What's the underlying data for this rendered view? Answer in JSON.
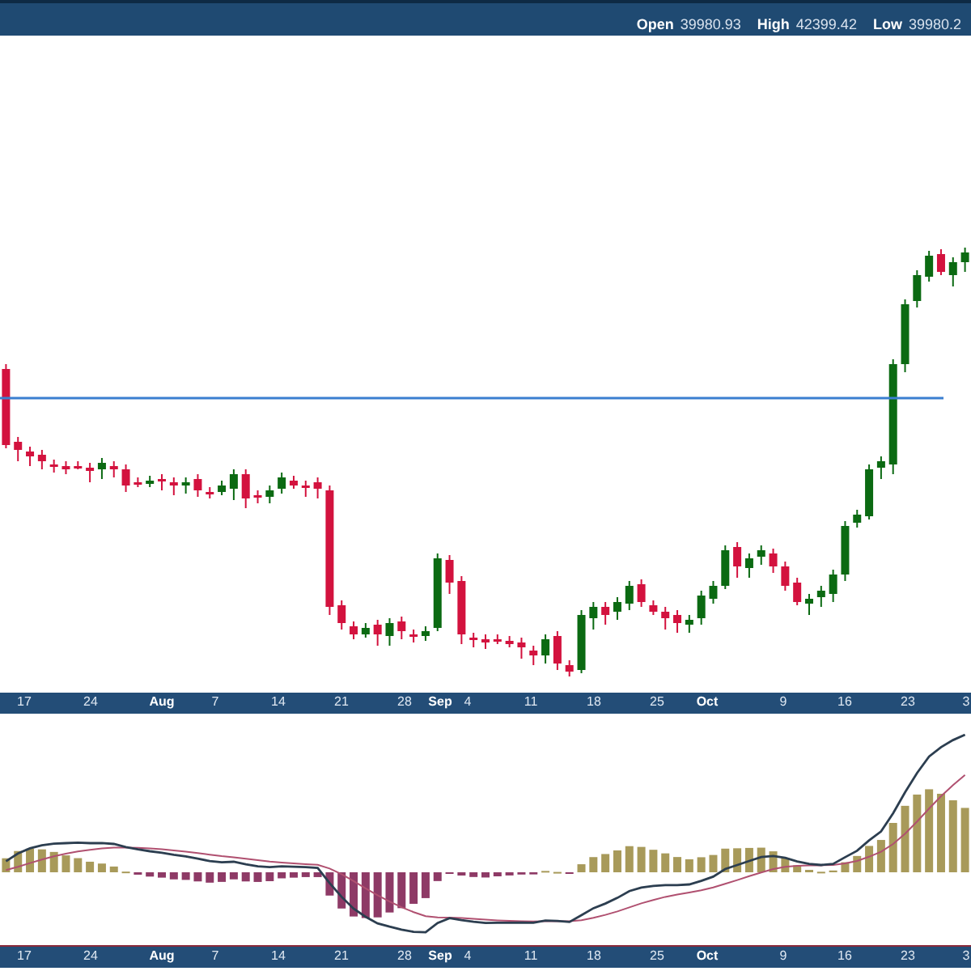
{
  "header": {
    "stats": [
      {
        "label": "Open",
        "value": "39980.93"
      },
      {
        "label": "High",
        "value": "42399.42"
      },
      {
        "label": "Low",
        "value": "39980.2"
      }
    ]
  },
  "price_panel": {
    "date_axis": [
      {
        "text": "17",
        "kind": "day"
      },
      {
        "text": "24",
        "kind": "day"
      },
      {
        "text": "Aug",
        "kind": "month"
      },
      {
        "text": "7",
        "kind": "day"
      },
      {
        "text": "14",
        "kind": "day"
      },
      {
        "text": "21",
        "kind": "day"
      },
      {
        "text": "28",
        "kind": "day"
      },
      {
        "text": "Sep",
        "kind": "month"
      },
      {
        "text": "4",
        "kind": "day"
      },
      {
        "text": "11",
        "kind": "day"
      },
      {
        "text": "18",
        "kind": "day"
      },
      {
        "text": "25",
        "kind": "day"
      },
      {
        "text": "Oct",
        "kind": "month"
      },
      {
        "text": "9",
        "kind": "day"
      },
      {
        "text": "16",
        "kind": "day"
      },
      {
        "text": "23",
        "kind": "day"
      },
      {
        "text": "3",
        "kind": "day"
      }
    ]
  },
  "indicator_panel": {
    "date_axis": [
      {
        "text": "17",
        "kind": "day"
      },
      {
        "text": "24",
        "kind": "day"
      },
      {
        "text": "Aug",
        "kind": "month"
      },
      {
        "text": "7",
        "kind": "day"
      },
      {
        "text": "14",
        "kind": "day"
      },
      {
        "text": "21",
        "kind": "day"
      },
      {
        "text": "28",
        "kind": "day"
      },
      {
        "text": "Sep",
        "kind": "month"
      },
      {
        "text": "4",
        "kind": "day"
      },
      {
        "text": "11",
        "kind": "day"
      },
      {
        "text": "18",
        "kind": "day"
      },
      {
        "text": "25",
        "kind": "day"
      },
      {
        "text": "Oct",
        "kind": "month"
      },
      {
        "text": "9",
        "kind": "day"
      },
      {
        "text": "16",
        "kind": "day"
      },
      {
        "text": "23",
        "kind": "day"
      },
      {
        "text": "3",
        "kind": "day"
      }
    ]
  }
}
